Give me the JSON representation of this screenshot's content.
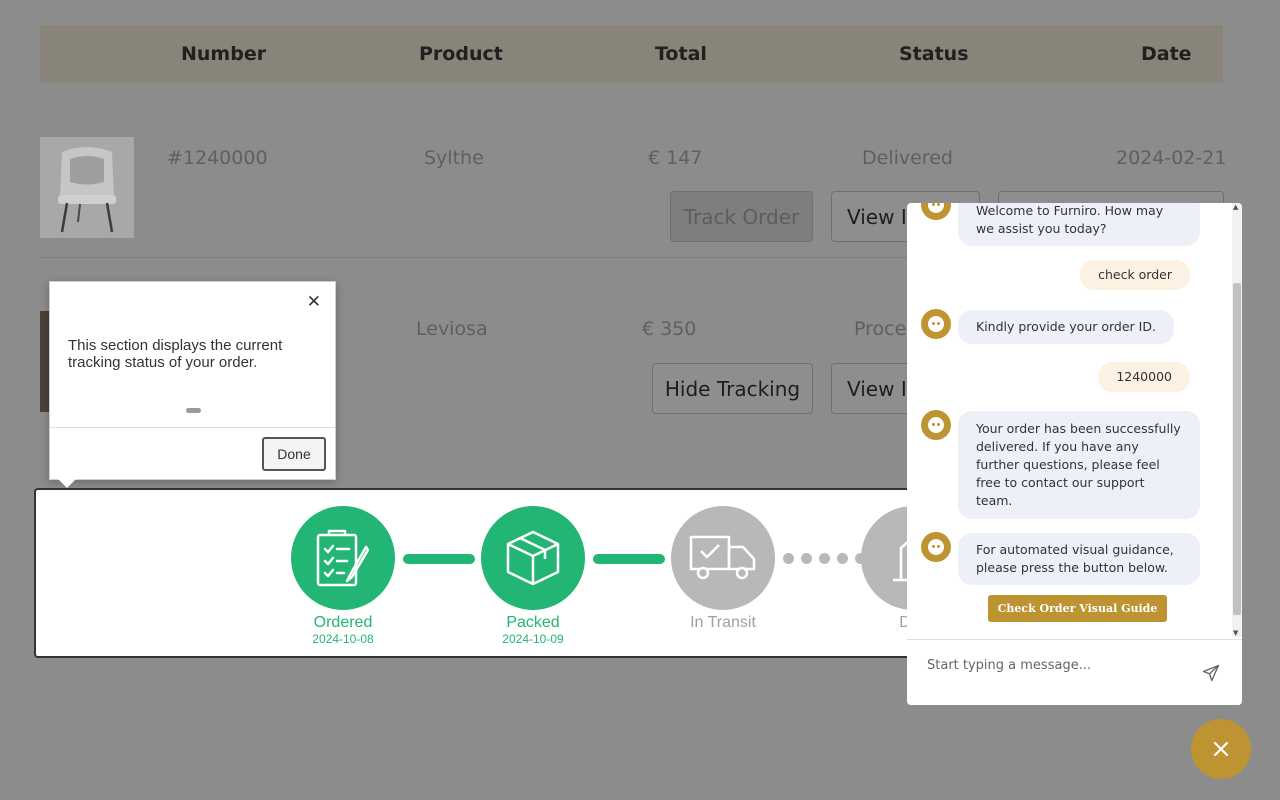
{
  "table": {
    "headers": {
      "number": "Number",
      "product": "Product",
      "total": "Total",
      "status": "Status",
      "date": "Date"
    }
  },
  "orders": [
    {
      "number": "#1240000",
      "product": "Sylthe",
      "total": "€ 147",
      "status": "Delivered",
      "date": "2024-02-21",
      "track_label": "Track Order",
      "view_label": "View In"
    },
    {
      "product": "Leviosa",
      "total": "€ 350",
      "status": "Proce",
      "hide_label": "Hide Tracking",
      "view_label": "View In"
    }
  ],
  "tracking": {
    "steps": [
      {
        "label": "Ordered",
        "date": "2024-10-08",
        "state": "done",
        "icon": "clipboard-icon"
      },
      {
        "label": "Packed",
        "date": "2024-10-09",
        "state": "done",
        "icon": "package-icon"
      },
      {
        "label": "In Transit",
        "date": "",
        "state": "pending",
        "icon": "truck-icon"
      },
      {
        "label": "Deli",
        "date": "",
        "state": "pending",
        "icon": "delivered-icon"
      }
    ],
    "colors": {
      "done": "#22b573",
      "pending": "#b8b8b8"
    }
  },
  "tooltip": {
    "close_symbol": "✕",
    "text": "This section displays the current tracking status of your order.",
    "done_label": "Done"
  },
  "chat": {
    "messages": [
      {
        "from": "bot",
        "text": "Welcome to Furniro. How may we assist you today?"
      },
      {
        "from": "user",
        "text": "check order"
      },
      {
        "from": "bot",
        "text": "Kindly provide your order ID."
      },
      {
        "from": "user",
        "text": "1240000"
      },
      {
        "from": "bot",
        "text": "Your order has been successfully delivered. If you have any further questions, please feel free to contact our support team."
      },
      {
        "from": "bot",
        "text": "For automated visual guidance, please press the button below."
      }
    ],
    "guide_button": "Check Order Visual Guide",
    "input_placeholder": "Start typing a message...",
    "accent_color": "#bd9431",
    "send_icon": "send-icon",
    "close_symbol": "✕"
  }
}
